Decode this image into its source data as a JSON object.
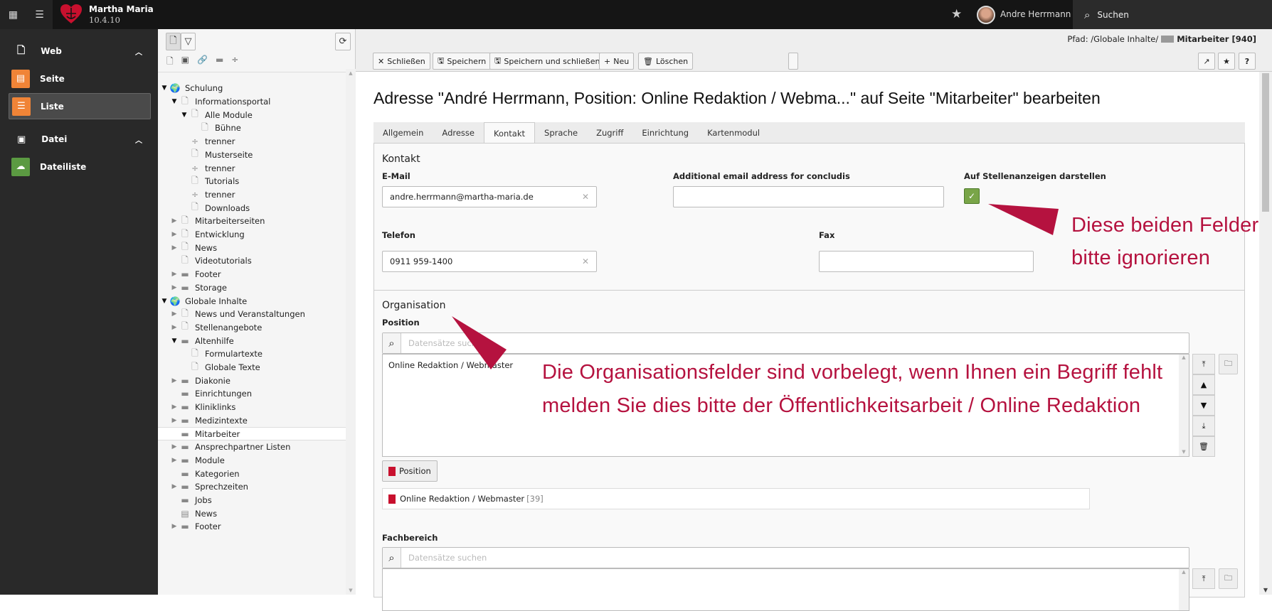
{
  "topbar": {
    "app_name": "Martha Maria",
    "version": "10.4.10",
    "user_name": "Andre Herrmann",
    "search_label": "Suchen",
    "brand_color": "#c8102e"
  },
  "sidebar": {
    "groups": [
      {
        "label": "Web",
        "items": [
          {
            "label": "Seite",
            "color": "#f08437"
          },
          {
            "label": "Liste",
            "color": "#f08437",
            "active": true
          }
        ]
      },
      {
        "label": "Datei",
        "items": [
          {
            "label": "Dateiliste",
            "color": "#5b9a42"
          }
        ]
      }
    ]
  },
  "tree": {
    "items": [
      {
        "label": "Schulung",
        "level": 0,
        "icon": "globe",
        "toggle": "open"
      },
      {
        "label": "Informationsportal",
        "level": 1,
        "icon": "page",
        "toggle": "open"
      },
      {
        "label": "Alle Module",
        "level": 2,
        "icon": "page",
        "toggle": "open"
      },
      {
        "label": "Bühne",
        "level": 3,
        "icon": "page"
      },
      {
        "label": "trenner",
        "level": 2,
        "icon": "divider"
      },
      {
        "label": "Musterseite",
        "level": 2,
        "icon": "page"
      },
      {
        "label": "trenner",
        "level": 2,
        "icon": "divider"
      },
      {
        "label": "Tutorials",
        "level": 2,
        "icon": "page"
      },
      {
        "label": "trenner",
        "level": 2,
        "icon": "divider"
      },
      {
        "label": "Downloads",
        "level": 2,
        "icon": "page"
      },
      {
        "label": "Mitarbeiterseiten",
        "level": 1,
        "icon": "page",
        "toggle": "closed"
      },
      {
        "label": "Entwicklung",
        "level": 1,
        "icon": "page",
        "toggle": "closed"
      },
      {
        "label": "News",
        "level": 1,
        "icon": "page",
        "toggle": "closed"
      },
      {
        "label": "Videotutorials",
        "level": 1,
        "icon": "page"
      },
      {
        "label": "Footer",
        "level": 1,
        "icon": "folder",
        "toggle": "closed"
      },
      {
        "label": "Storage",
        "level": 1,
        "icon": "folder",
        "toggle": "closed"
      },
      {
        "label": "Globale Inhalte",
        "level": 0,
        "icon": "globe",
        "toggle": "open"
      },
      {
        "label": "News und Veranstaltungen",
        "level": 1,
        "icon": "page",
        "toggle": "closed"
      },
      {
        "label": "Stellenangebote",
        "level": 1,
        "icon": "page",
        "toggle": "closed"
      },
      {
        "label": "Altenhilfe",
        "level": 1,
        "icon": "folder",
        "toggle": "open"
      },
      {
        "label": "Formulartexte",
        "level": 2,
        "icon": "page"
      },
      {
        "label": "Globale Texte",
        "level": 2,
        "icon": "page"
      },
      {
        "label": "Diakonie",
        "level": 1,
        "icon": "folder",
        "toggle": "closed"
      },
      {
        "label": "Einrichtungen",
        "level": 1,
        "icon": "folder"
      },
      {
        "label": "Kliniklinks",
        "level": 1,
        "icon": "folder",
        "toggle": "closed"
      },
      {
        "label": "Medizintexte",
        "level": 1,
        "icon": "folder",
        "toggle": "closed"
      },
      {
        "label": "Mitarbeiter",
        "level": 1,
        "icon": "folder",
        "selected": true
      },
      {
        "label": "Ansprechpartner Listen",
        "level": 1,
        "icon": "folder",
        "toggle": "closed"
      },
      {
        "label": "Module",
        "level": 1,
        "icon": "folder",
        "toggle": "closed"
      },
      {
        "label": "Kategorien",
        "level": 1,
        "icon": "folder"
      },
      {
        "label": "Sprechzeiten",
        "level": 1,
        "icon": "folder",
        "toggle": "closed"
      },
      {
        "label": "Jobs",
        "level": 1,
        "icon": "folder"
      },
      {
        "label": "News",
        "level": 1,
        "icon": "news-folder"
      },
      {
        "label": "Footer",
        "level": 1,
        "icon": "folder",
        "toggle": "closed"
      }
    ]
  },
  "dochead": {
    "path_prefix": "Pfad: /Globale Inhalte/",
    "path_page": "Mitarbeiter [940]",
    "buttons": {
      "close": "Schließen",
      "save": "Speichern",
      "save_close": "Speichern und schließen",
      "new": "Neu",
      "delete": "Löschen"
    },
    "help": "?"
  },
  "main": {
    "title": "Adresse \"André Herrmann, Position: Online Redaktion / Webma...\" auf Seite \"Mitarbeiter\" bearbeiten",
    "tabs": [
      "Allgemein",
      "Adresse",
      "Kontakt",
      "Sprache",
      "Zugriff",
      "Einrichtung",
      "Kartenmodul"
    ],
    "active_tab": "Kontakt",
    "kontakt": {
      "heading": "Kontakt",
      "email_label": "E-Mail",
      "email_value": "andre.herrmann@martha-maria.de",
      "additional_label": "Additional email address for concludis",
      "additional_value": "",
      "jobs_label": "Auf Stellenanzeigen darstellen",
      "jobs_checked": true,
      "phone_label": "Telefon",
      "phone_value": "0911 959-1400",
      "fax_label": "Fax",
      "fax_value": ""
    },
    "organisation": {
      "heading": "Organisation",
      "position_label": "Position",
      "search_placeholder": "Datensätze suchen",
      "position_selected_list": [
        "Online Redaktion / Webmaster"
      ],
      "position_button": "Position",
      "position_item": "Online Redaktion / Webmaster",
      "position_item_id": "[39]",
      "fachbereich_label": "Fachbereich",
      "fachbereich_placeholder": "Datensätze suchen"
    }
  },
  "annotations": {
    "color": "#b5123f",
    "note1_line1": "Diese beiden Felder",
    "note1_line2": "bitte ignorieren",
    "note2_line1": "Die Organisationsfelder sind vorbelegt, wenn Ihnen ein Begriff fehlt",
    "note2_line2": "melden Sie dies bitte der Öffentlichkeitsarbeit / Online Redaktion"
  }
}
